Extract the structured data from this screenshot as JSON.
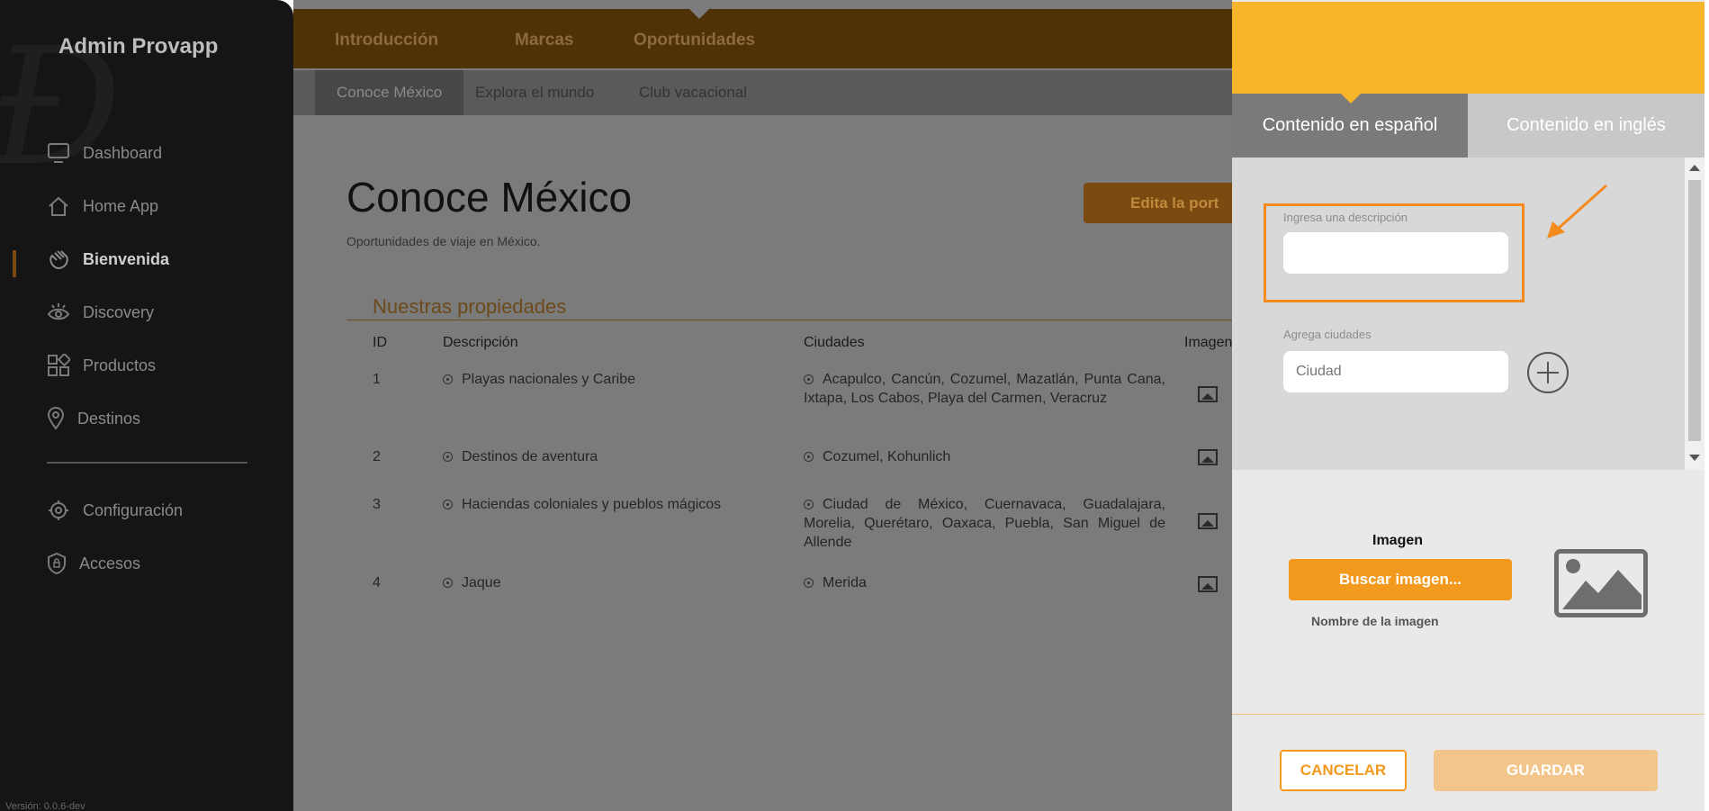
{
  "sidebar": {
    "brand": "Admin Provapp",
    "items": [
      {
        "label": "Dashboard",
        "icon": "monitor-icon"
      },
      {
        "label": "Home App",
        "icon": "home-icon"
      },
      {
        "label": "Bienvenida",
        "icon": "wave-hand-icon",
        "active": true
      },
      {
        "label": "Discovery",
        "icon": "eye-icon"
      },
      {
        "label": "Productos",
        "icon": "grid-icon"
      },
      {
        "label": "Destinos",
        "icon": "pin-icon"
      },
      {
        "label": "Configuración",
        "icon": "gear-icon"
      },
      {
        "label": "Accesos",
        "icon": "shield-icon"
      }
    ],
    "version": "Versión: 0.0.6-dev"
  },
  "topnav": {
    "items": [
      "Introducción",
      "Marcas",
      "Oportunidades"
    ]
  },
  "subnav": {
    "items": [
      "Conoce México",
      "Explora el mundo",
      "Club vacacional"
    ]
  },
  "page": {
    "title": "Conoce México",
    "subtitle": "Oportunidades de viaje en México.",
    "edit_label": "Edita la port",
    "section_title": "Nuestras propiedades"
  },
  "table": {
    "headers": [
      "ID",
      "Descripción",
      "Ciudades",
      "Imagen"
    ],
    "rows": [
      {
        "id": "1",
        "desc": "Playas nacionales y Caribe",
        "cities": "Acapulco, Cancún, Cozumel, Mazatlán, Punta Cana, Ixtapa, Los Cabos, Playa del Carmen, Veracruz"
      },
      {
        "id": "2",
        "desc": "Destinos de aventura",
        "cities": "Cozumel, Kohunlich"
      },
      {
        "id": "3",
        "desc": "Haciendas coloniales y pueblos mágicos",
        "cities": "Ciudad de México, Cuernavaca, Guadalajara, Morelia, Querétaro, Oaxaca, Puebla, San Miguel de Allende"
      },
      {
        "id": "4",
        "desc": "Jaque",
        "cities": "Merida"
      }
    ]
  },
  "panel": {
    "tab_es": "Contenido en español",
    "tab_en": "Contenido en inglés",
    "desc_label": "Ingresa una descripción",
    "desc_value": "",
    "cities_label": "Agrega ciudades",
    "city_placeholder": "Ciudad",
    "image_label": "Imagen",
    "search_image": "Buscar imagen...",
    "image_name": "Nombre de la imagen",
    "cancel": "CANCELAR",
    "save": "GUARDAR"
  },
  "colors": {
    "accent": "#f39a1e",
    "header": "#f7b52b",
    "highlight": "#f58a1f"
  }
}
